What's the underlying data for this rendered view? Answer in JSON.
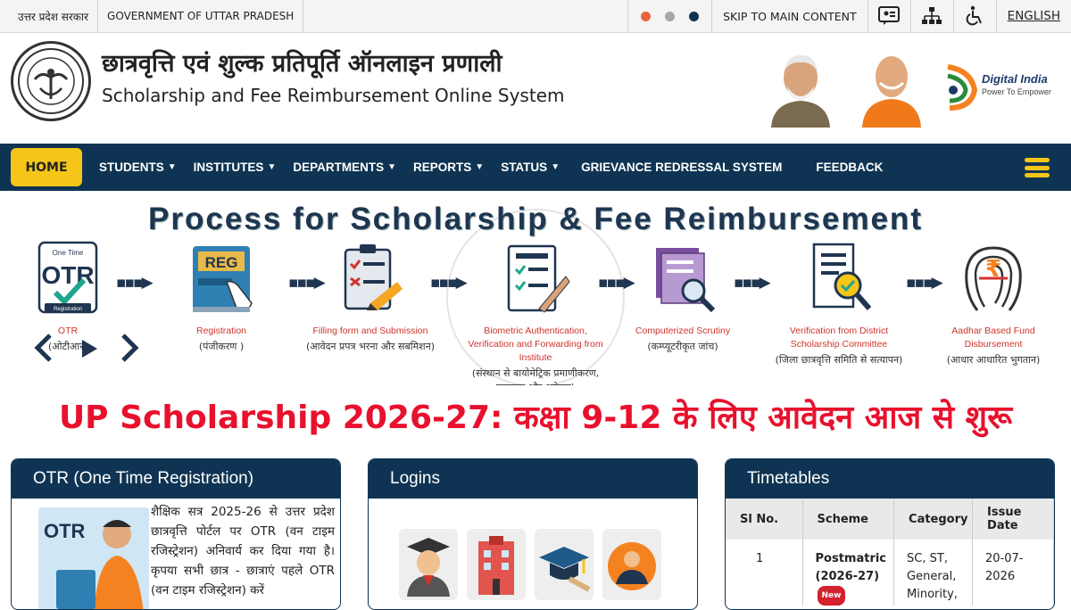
{
  "topbar": {
    "gov_hindi": "उत्तर प्रदेश सरकार",
    "gov_english": "GOVERNMENT OF UTTAR PRADESH",
    "skip": "SKIP TO MAIN CONTENT",
    "language": "ENGLISH",
    "theme_colors": [
      "#e8663a",
      "#a8a8a8",
      "#0f3453"
    ]
  },
  "header": {
    "title_hindi": "छात्रवृत्ति एवं शुल्क प्रतिपूर्ति ऑनलाइन प्रणाली",
    "title_english": "Scholarship and Fee Reimbursement Online System",
    "digital_india": "Digital India",
    "digital_india_tagline": "Power To Empower"
  },
  "nav": {
    "home": "HOME",
    "items": [
      "STUDENTS",
      "INSTITUTES",
      "DEPARTMENTS",
      "REPORTS",
      "STATUS",
      "GRIEVANCE REDRESSAL SYSTEM",
      "FEEDBACK"
    ],
    "caret": "⌄"
  },
  "banner": {
    "title": "Process for Scholarship & Fee Reimbursement",
    "steps": [
      {
        "en": "OTR",
        "hi": "(ओटीआर)"
      },
      {
        "en": "Registration",
        "hi": "(पंजीकरण )"
      },
      {
        "en": "Filling form and Submission",
        "hi": "(आवेदन प्रपत्र भरना और सबमिशन)"
      },
      {
        "en": "Biometric Authentication, Verification and Forwarding from Institute",
        "hi": "(संस्थान से बायोमेट्रिक प्रमाणीकरण, सत्यापन और अग्रेषण)"
      },
      {
        "en": "Computerized Scrutiny",
        "hi": "(कम्प्यूटरीकृत जांच)"
      },
      {
        "en": "Verification from District Scholarship Committee",
        "hi": "(जिला छात्रवृत्ति समिति से सत्यापन)"
      },
      {
        "en": "Aadhar Based Fund Disbursement",
        "hi": "(आधार आधारित भुगतान)"
      }
    ],
    "otr_icon_text": "OTR",
    "otr_icon_top": "One Time",
    "otr_icon_bottom": "Registration",
    "reg_icon_text": "REG"
  },
  "headline": "UP Scholarship 2026-27: कक्षा 9-12 के लिए आवेदन आज से शुरू",
  "cards": {
    "otr": {
      "title": "OTR (One Time Registration)",
      "image_text": "OTR",
      "text": "शैक्षिक सत्र 2025-26 से उत्तर प्रदेश छात्रवृत्ति पोर्टल पर OTR (वन टाइम रजिस्ट्रेशन) अनिवार्य कर दिया गया है। कृपया सभी छात्र - छात्राएं पहले OTR (वन टाइम रजिस्ट्रेशन) करें"
    },
    "logins": {
      "title": "Logins"
    },
    "timetables": {
      "title": "Timetables",
      "columns": [
        "Sl No.",
        "Scheme",
        "Category",
        "Issue Date"
      ],
      "rows": [
        {
          "sl": "1",
          "scheme": "Postmatric (2026-27)",
          "badge": "New",
          "category": "SC, ST, General, Minority,",
          "date": "20-07-2026"
        }
      ]
    }
  }
}
